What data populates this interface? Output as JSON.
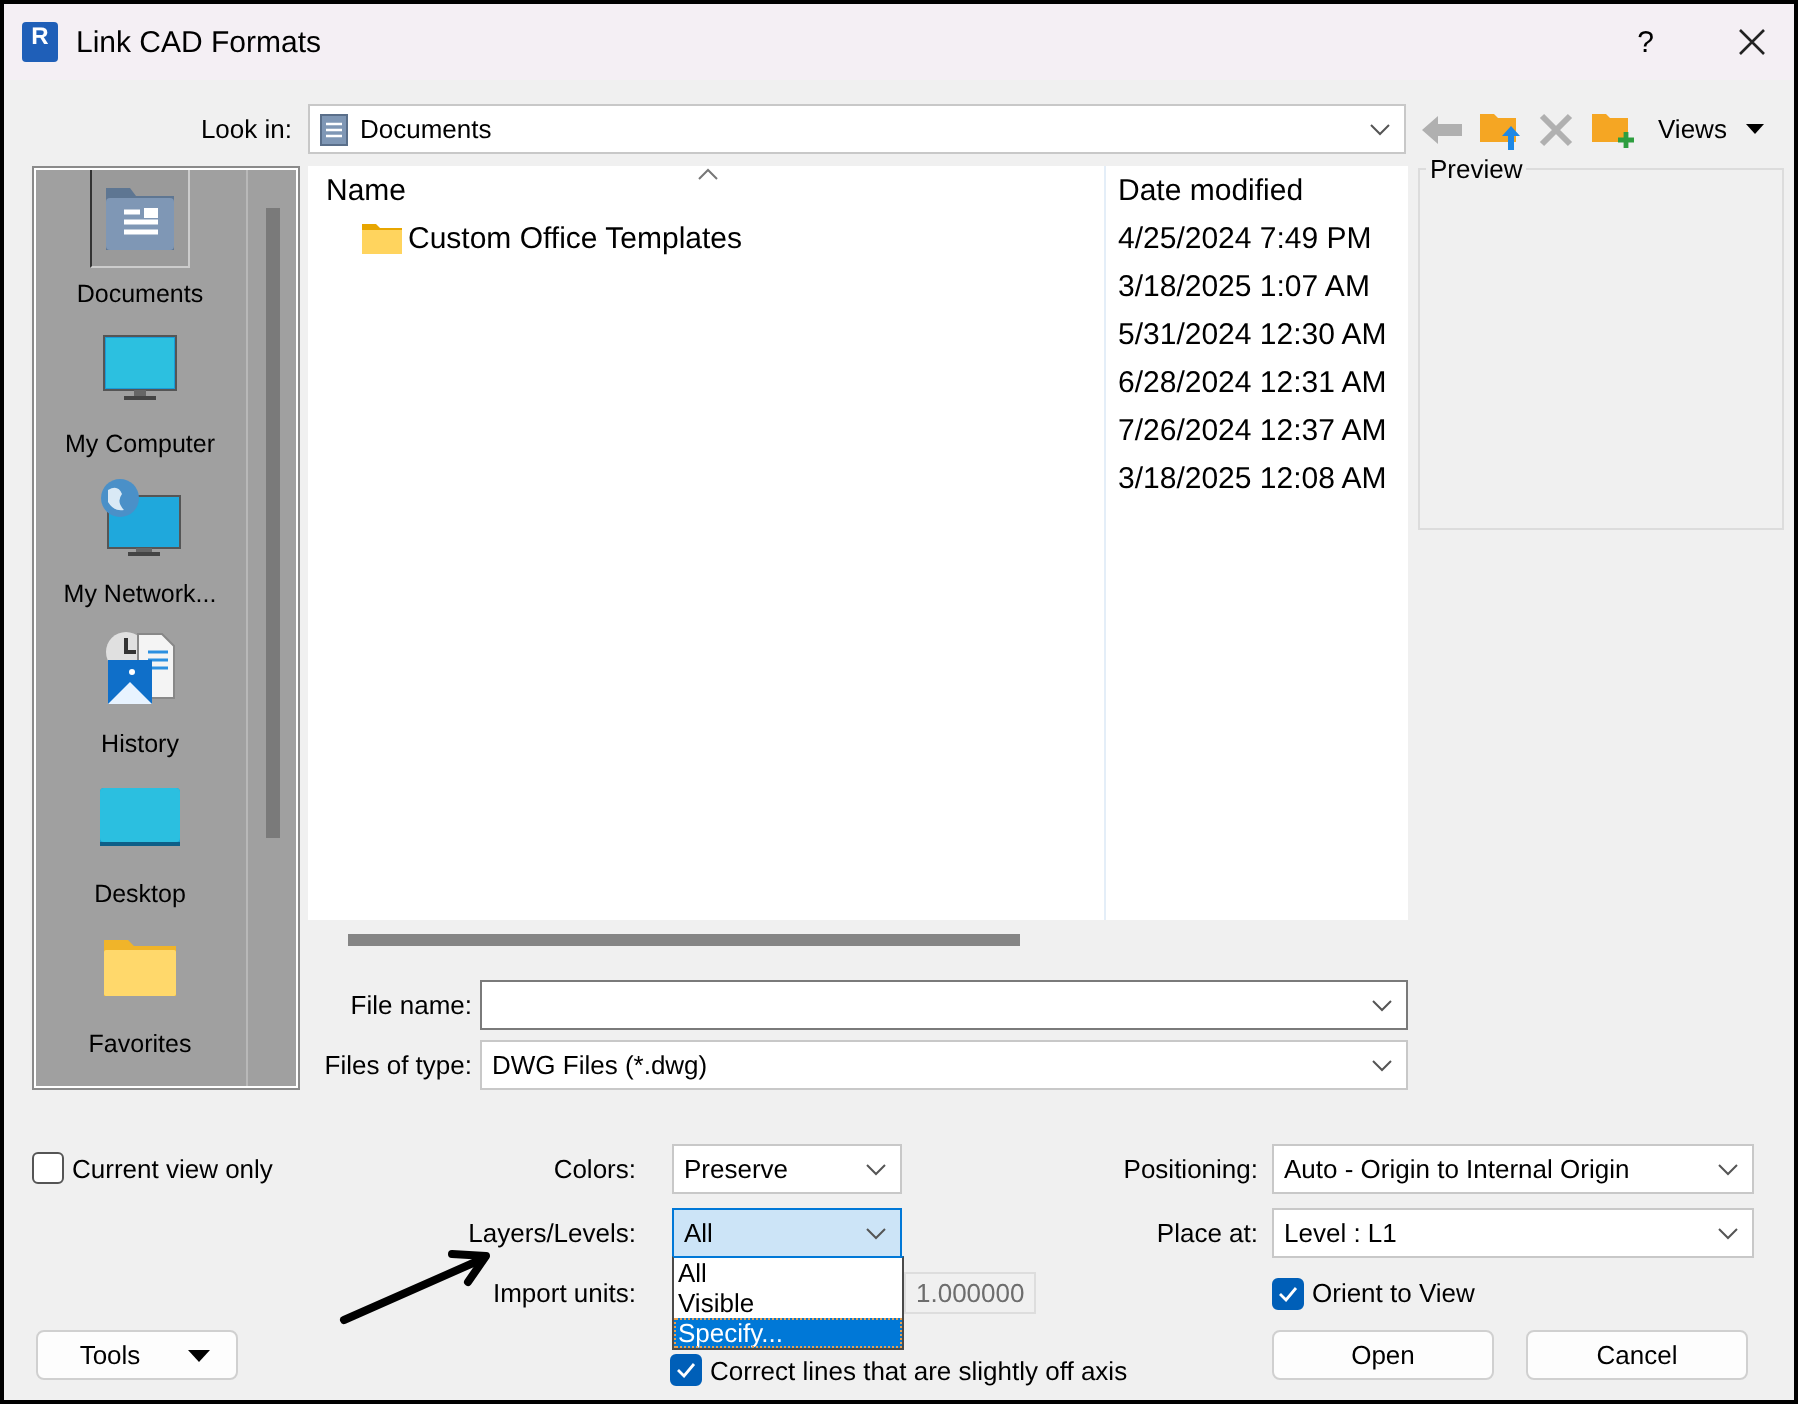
{
  "window": {
    "app_icon_letter": "R",
    "title": "Link CAD Formats",
    "help": "?"
  },
  "look_in": {
    "label": "Look in:",
    "value": "Documents"
  },
  "toolbar": [
    {
      "kind": "back",
      "disabled": true
    },
    {
      "kind": "up-folder",
      "disabled": false
    },
    {
      "kind": "delete",
      "disabled": true
    },
    {
      "kind": "new-folder",
      "disabled": false
    }
  ],
  "views": {
    "label": "Views"
  },
  "places": [
    {
      "label": "Documents",
      "kind": "documents",
      "selected": true
    },
    {
      "label": "My Computer",
      "kind": "computer",
      "selected": false
    },
    {
      "label": "My Network...",
      "kind": "network",
      "selected": false
    },
    {
      "label": "History",
      "kind": "history",
      "selected": false
    },
    {
      "label": "Desktop",
      "kind": "desktop",
      "selected": false
    },
    {
      "label": "Favorites",
      "kind": "folder",
      "selected": false
    }
  ],
  "file_list": {
    "columns": [
      "Name",
      "Date modified"
    ],
    "rows": [
      {
        "name": "Custom Office Templates",
        "date": "4/25/2024 7:49 PM"
      },
      {
        "date": "3/18/2025 1:07 AM"
      },
      {
        "date": "5/31/2024 12:30 AM"
      },
      {
        "date": "6/28/2024 12:31 AM"
      },
      {
        "date": "7/26/2024 12:37 AM"
      },
      {
        "date": "3/18/2025 12:08 AM"
      }
    ]
  },
  "preview": {
    "label": "Preview"
  },
  "file_name": {
    "label": "File name:"
  },
  "file_type": {
    "label": "Files of type:",
    "value": "DWG Files (*.dwg)"
  },
  "options": {
    "current_view_only": {
      "label": "Current view only",
      "checked": false
    },
    "colors": {
      "label": "Colors:",
      "value": "Preserve"
    },
    "layers": {
      "label": "Layers/Levels:",
      "value": "All",
      "expanded": true
    },
    "layer_options": [
      {
        "label": "All",
        "selected": false
      },
      {
        "label": "Visible",
        "selected": false
      },
      {
        "label": "Specify...",
        "selected": true
      }
    ],
    "import_units": {
      "label": "Import units:",
      "value": "1.000000",
      "disabled": true
    },
    "correct_lines": {
      "label": "Correct lines that are slightly off axis",
      "checked": true
    },
    "positioning": {
      "label": "Positioning:",
      "value": "Auto - Origin to Internal Origin"
    },
    "place_at": {
      "label": "Place at:",
      "value": "Level : L1"
    },
    "orient_to_view": {
      "label": "Orient to View",
      "checked": true
    }
  },
  "buttons": {
    "tools": "Tools",
    "open": "Open",
    "cancel": "Cancel"
  }
}
